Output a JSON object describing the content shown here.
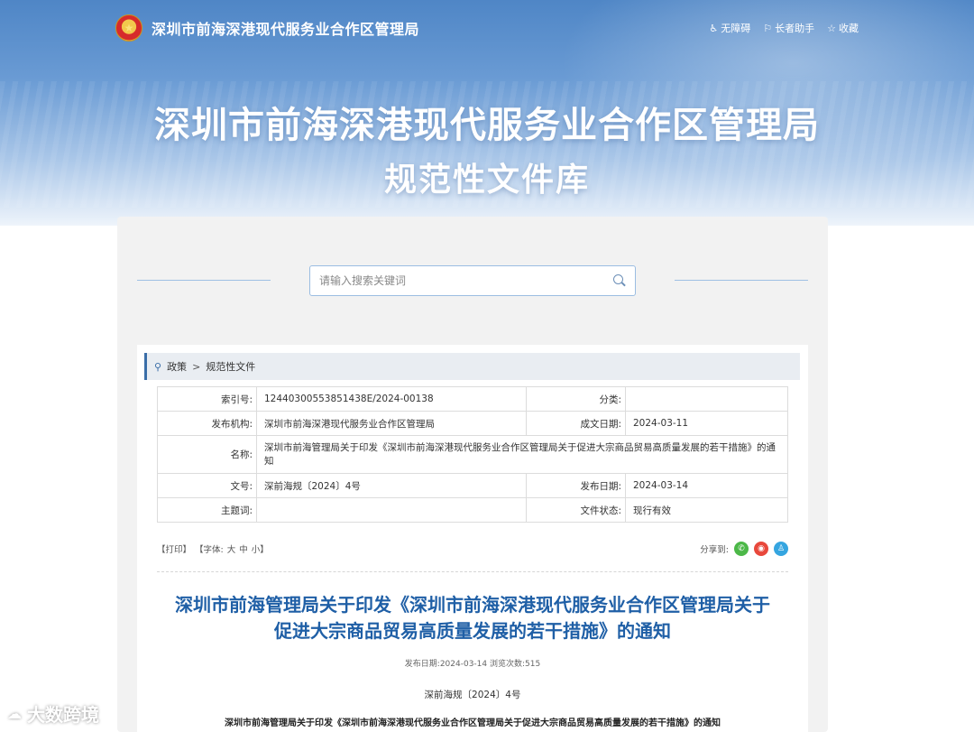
{
  "header": {
    "site_name": "深圳市前海深港现代服务业合作区管理局",
    "tools": [
      {
        "icon": "accessibility-icon",
        "glyph": "♿",
        "label": "无障碍"
      },
      {
        "icon": "elder-assist-icon",
        "glyph": "⚐",
        "label": "长者助手"
      },
      {
        "icon": "star-icon",
        "glyph": "☆",
        "label": "收藏"
      }
    ],
    "title": "深圳市前海深港现代服务业合作区管理局",
    "subtitle": "规范性文件库"
  },
  "search": {
    "placeholder": "请输入搜索关键词"
  },
  "breadcrumb": {
    "items": [
      "政策",
      "规范性文件"
    ],
    "separator": ">"
  },
  "info": {
    "index_label": "索引号:",
    "index_value": "12440300553851438E/2024-00138",
    "category_label": "分类:",
    "category_value": "",
    "issuer_label": "发布机构:",
    "issuer_value": "深圳市前海深港现代服务业合作区管理局",
    "created_label": "成文日期:",
    "created_value": "2024-03-11",
    "name_label": "名称:",
    "name_value": "深圳市前海管理局关于印发《深圳市前海深港现代服务业合作区管理局关于促进大宗商品贸易高质量发展的若干措施》的通知",
    "docno_label": "文号:",
    "docno_value": "深前海规〔2024〕4号",
    "published_label": "发布日期:",
    "published_value": "2024-03-14",
    "keywords_label": "主题词:",
    "keywords_value": "",
    "status_label": "文件状态:",
    "status_value": "现行有效"
  },
  "toolbar": {
    "print": "【打印】",
    "font_label": "【字体:",
    "font_large": "大",
    "font_medium": "中",
    "font_small": "小】",
    "share_label": "分享到:"
  },
  "document": {
    "title_line1": "深圳市前海管理局关于印发《深圳市前海深港现代服务业合作区管理局关于",
    "title_line2": "促进大宗商品贸易高质量发展的若干措施》的通知",
    "meta": "发布日期:2024-03-14  浏览次数:515",
    "doc_number": "深前海规〔2024〕4号",
    "first_line": "深圳市前海管理局关于印发《深圳市前海深港现代服务业合作区管理局关于促进大宗商品贸易高质量发展的若干措施》的通知"
  },
  "watermark": {
    "text": "大数跨境"
  },
  "colors": {
    "banner": "#4f86c6",
    "title_blue": "#1f5fa6",
    "accent": "#3a6ea8"
  }
}
